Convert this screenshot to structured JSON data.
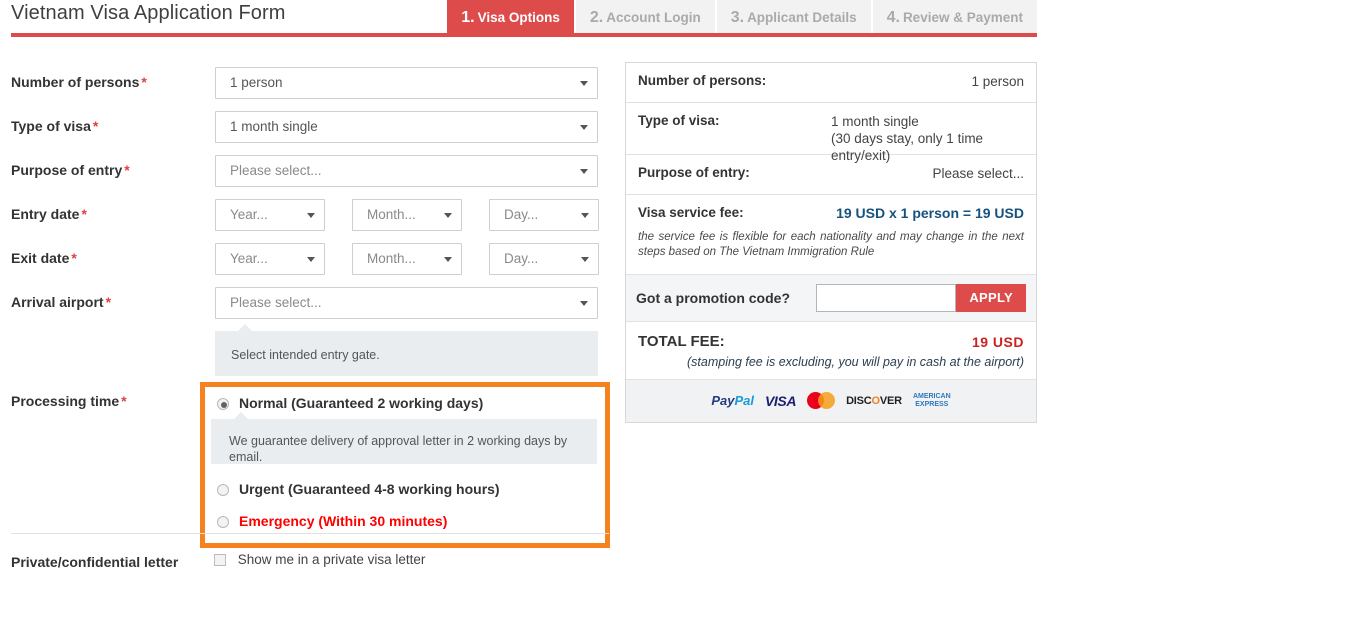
{
  "header": {
    "title": "Vietnam Visa Application Form",
    "tabs": [
      {
        "num": "1.",
        "label": "Visa Options",
        "active": true
      },
      {
        "num": "2.",
        "label": "Account Login",
        "active": false
      },
      {
        "num": "3.",
        "label": "Applicant Details",
        "active": false
      },
      {
        "num": "4.",
        "label": "Review & Payment",
        "active": false
      }
    ]
  },
  "form": {
    "number_of_persons": {
      "label": "Number of persons",
      "required": "*",
      "value": "1 person"
    },
    "type_of_visa": {
      "label": "Type of visa",
      "required": "*",
      "value": "1 month single"
    },
    "purpose_of_entry": {
      "label": "Purpose of entry",
      "required": "*",
      "value": "Please select..."
    },
    "entry_date": {
      "label": "Entry date",
      "required": "*",
      "year": "Year...",
      "month": "Month...",
      "day": "Day..."
    },
    "exit_date": {
      "label": "Exit date",
      "required": "*",
      "year": "Year...",
      "month": "Month...",
      "day": "Day..."
    },
    "arrival_airport": {
      "label": "Arrival airport",
      "required": "*",
      "value": "Please select...",
      "hint": "Select intended entry gate."
    },
    "processing_time": {
      "label": "Processing time",
      "required": "*",
      "options": [
        {
          "label": "Normal (Guaranteed 2 working days)",
          "selected": true,
          "style": "normal"
        },
        {
          "label": "Urgent (Guaranteed 4-8 working hours)",
          "selected": false,
          "style": "normal"
        },
        {
          "label": "Emergency (Within 30 minutes)",
          "selected": false,
          "style": "emergency"
        }
      ],
      "hint": "We guarantee delivery of approval letter in 2 working days by email."
    },
    "private_letter": {
      "label": "Private/confidential letter",
      "checkbox_label": "Show me in a private visa letter",
      "checked": false
    }
  },
  "summary": {
    "number_of_persons": {
      "key": "Number of persons:",
      "value": "1 person"
    },
    "type_of_visa": {
      "key": "Type of visa:",
      "value_line1": "1 month single",
      "value_line2": "(30 days stay, only 1 time entry/exit)"
    },
    "purpose_of_entry": {
      "key": "Purpose of entry:",
      "value": "Please select..."
    },
    "visa_service_fee": {
      "key": "Visa service fee:",
      "value": "19 USD x 1 person = 19 USD",
      "note": "the service fee is flexible for each nationality and may change in the next steps based on The Vietnam Immigration Rule"
    },
    "promotion": {
      "label": "Got a promotion code?",
      "input_value": "",
      "input_placeholder": "",
      "apply_label": "APPLY"
    },
    "total": {
      "key": "TOTAL FEE:",
      "value": "19 USD",
      "note": "(stamping fee is excluding, you will pay in cash at the airport)"
    },
    "payment_logos": [
      {
        "name": "paypal-logo",
        "text": "PayPal"
      },
      {
        "name": "visa-logo",
        "text": "VISA"
      },
      {
        "name": "mastercard-logo",
        "text": ""
      },
      {
        "name": "discover-logo",
        "text": "DISCOVER"
      },
      {
        "name": "amex-logo",
        "line1": "AMERICAN",
        "line2": "EXPRESS"
      }
    ]
  },
  "colors": {
    "accent_red": "#dd4b4b",
    "highlight_orange": "#f5821f",
    "fee_blue": "#15527f",
    "total_red": "#cc2222",
    "emergency_red": "#ff0000"
  }
}
